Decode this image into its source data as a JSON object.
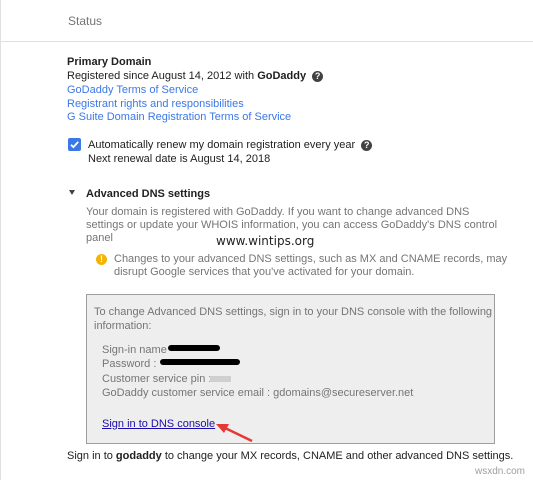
{
  "header": {
    "title": "Status"
  },
  "primary_domain": {
    "heading": "Primary Domain",
    "registered_text": "Registered since August 14, 2012 with ",
    "registrar": "GoDaddy",
    "links": [
      "GoDaddy Terms of Service",
      "Registrant rights and responsibilities",
      "G Suite Domain Registration Terms of Service"
    ]
  },
  "auto_renew": {
    "label": "Automatically renew my domain registration every year",
    "checked": true,
    "next_renewal": "Next renewal date is August 14, 2018"
  },
  "advanced_dns": {
    "heading": "Advanced DNS settings",
    "description": [
      "Your domain is registered with GoDaddy. If you want to change advanced DNS",
      "settings or update your WHOIS information, you can access GoDaddy's DNS control",
      "panel"
    ],
    "warning": [
      "Changes to your advanced DNS settings, such as MX and CNAME records, may",
      "disrupt Google services that you've activated for your domain."
    ]
  },
  "dns_box": {
    "intro": [
      "To change Advanced DNS settings, sign in to your DNS console with the following",
      "information:"
    ],
    "signin_name_label": "Sign-in name",
    "password_label": "Password :",
    "pin_label": "Customer service pin :",
    "email_label": "GoDaddy customer service email : gdomains@secureserver.net",
    "console_link": "Sign in to DNS console"
  },
  "footer": {
    "pre": "Sign in to ",
    "bold": "godaddy",
    "post": " to change your MX records, CNAME and other advanced DNS settings."
  },
  "watermark": "www.wintips.org",
  "credit": "wsxdn.com",
  "colors": {
    "accent": "#3b78e7",
    "warning": "#f4b400",
    "arrow": "#e53935"
  }
}
